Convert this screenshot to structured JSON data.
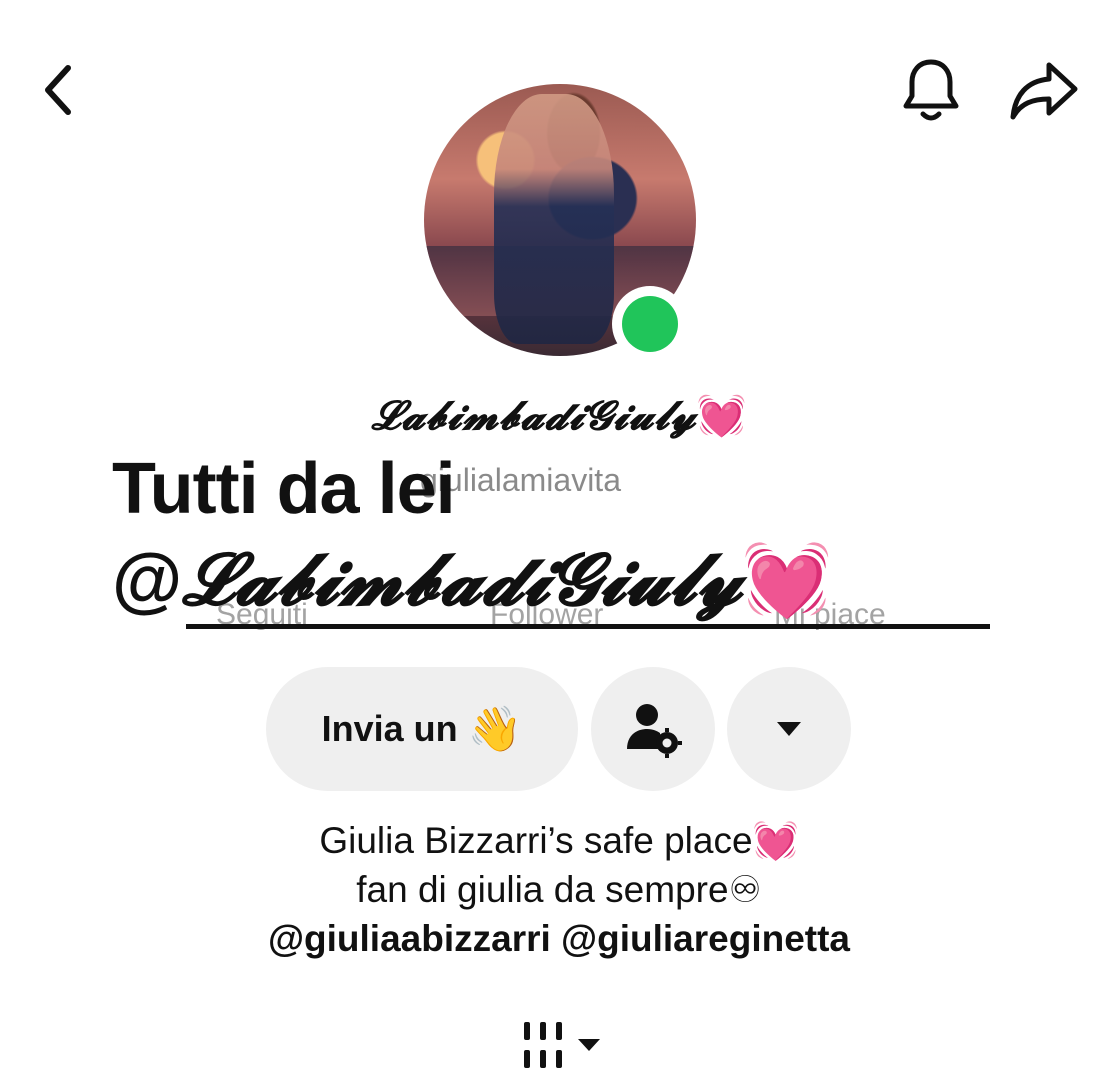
{
  "header": {
    "back_icon": "chevron-left-icon",
    "bell_icon": "bell-icon",
    "share_icon": "share-arrow-icon"
  },
  "profile": {
    "display_name": "𝓛𝓪𝓫𝓲𝓶𝓫𝓪𝓭𝓲𝓖𝓲𝓾𝓵𝔂",
    "display_name_emoji": "💓",
    "username": "giulialamiavita",
    "online_color": "#20c55a"
  },
  "overlay": {
    "line1": "Tutti da lei",
    "line2_at": "@",
    "line2_name": "𝓛𝓪𝓫𝓲𝓶𝓫𝓪𝓭𝓲𝓖𝓲𝓾𝓵𝔂",
    "line2_emoji": "💓"
  },
  "stats_labels": {
    "following": "Seguiti",
    "followers": "Follower",
    "likes": "Mi piace"
  },
  "actions": {
    "wave_label": "Invia un",
    "wave_emoji": "👋",
    "friend_settings_icon": "person-gear-icon",
    "more_icon": "caret-down-icon"
  },
  "bio": {
    "line1": "Giulia Bizzarri’s safe place💓",
    "line2": "fan di giulia da sempre♾",
    "line3": "@giuliaabizzarri @giuliareginetta"
  },
  "tabs": {
    "grid_icon": "grid-bars-icon",
    "grid_caret": "caret-down-icon"
  }
}
